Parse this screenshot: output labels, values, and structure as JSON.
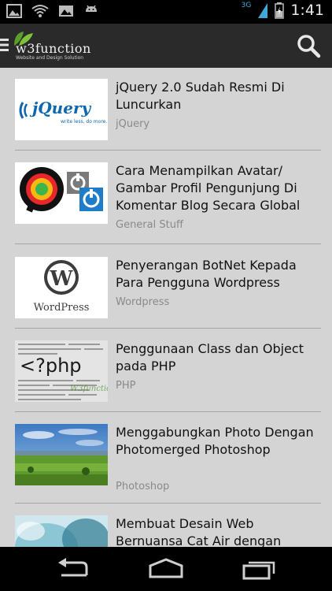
{
  "status_bar": {
    "time": "1:41",
    "network": "3G",
    "left_icons": [
      "picture-icon",
      "wifi-icon",
      "image-icon",
      "android-icon"
    ],
    "right_icons": [
      "signal-icon",
      "battery-icon"
    ]
  },
  "action_bar": {
    "logo_text": "w3function",
    "logo_subtitle": "Website and Design Solution",
    "menu_icon": "menu-icon",
    "search_icon": "search-icon"
  },
  "posts": [
    {
      "title": "jQuery 2.0 Sudah Resmi Di Luncurkan",
      "category": "jQuery",
      "thumb_text": "jQuery",
      "thumb_sub": "write less, do more."
    },
    {
      "title": "Cara Menampilkan Avatar/ Gambar Profil Pengunjung Di Komentar Blog Secara Global",
      "category": "General Stuff"
    },
    {
      "title": "Penyerangan BotNet Kepada Para Pengguna Wordpress",
      "category": "Wordpress",
      "thumb_text": "WordPress"
    },
    {
      "title": "Penggunaan Class dan Object pada PHP",
      "category": "PHP",
      "thumb_text": "<?php"
    },
    {
      "title": "Menggabungkan Photo Dengan Photomerged Photoshop",
      "category": "Photoshop"
    },
    {
      "title": "Membuat Desain Web Bernuansa Cat Air dengan",
      "category": ""
    }
  ],
  "nav_bar": {
    "back_icon": "back-icon",
    "home_icon": "home-icon",
    "recents_icon": "recent-apps-icon"
  },
  "colors": {
    "status_bar": "#000000",
    "action_bar": "#2a2a2a",
    "background": "#d4d4d4",
    "title": "#111111",
    "category": "#8a8a8a",
    "accent_blue": "#3fa9d8"
  }
}
